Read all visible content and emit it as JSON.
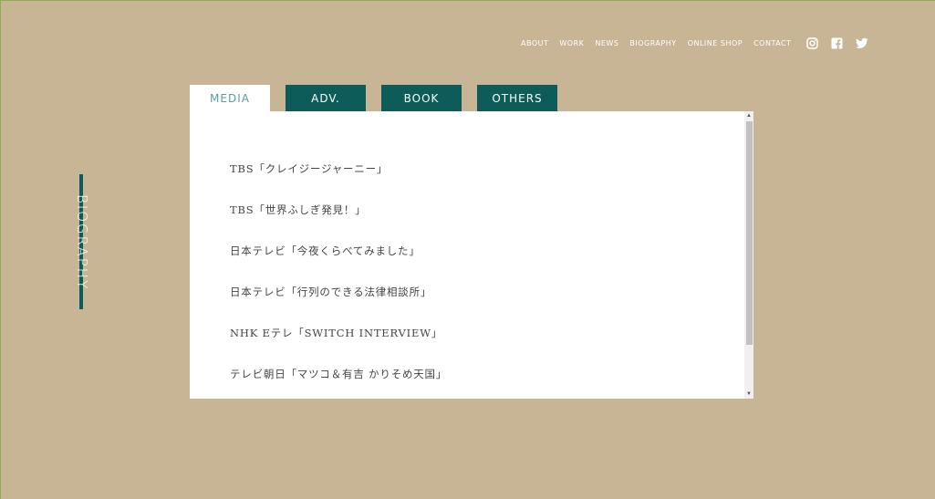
{
  "nav": {
    "items": [
      "ABOUT",
      "WORK",
      "NEWS",
      "BIOGRAPHY",
      "ONLINE SHOP",
      "CONTACT"
    ]
  },
  "social": {
    "icons": [
      "instagram-icon",
      "facebook-icon",
      "twitter-icon"
    ]
  },
  "side": {
    "label": "BIOGRAPHY"
  },
  "tabs": [
    {
      "label": "MEDIA",
      "active": true
    },
    {
      "label": "ADV.",
      "active": false
    },
    {
      "label": "BOOK",
      "active": false
    },
    {
      "label": "OTHERS",
      "active": false
    }
  ],
  "media_list": [
    "TBS「クレイジージャーニー」",
    "TBS「世界ふしぎ発見！」",
    "日本テレビ「今夜くらべてみました」",
    "日本テレビ「行列のできる法律相談所」",
    "NHK Eテレ「SWITCH INTERVIEW」",
    "テレビ朝日「マツコ＆有吉 かりそめ天国」"
  ],
  "colors": {
    "background": "#c8b596",
    "accent": "#0d5c5a",
    "active_tab_text": "#5a9ea0"
  }
}
